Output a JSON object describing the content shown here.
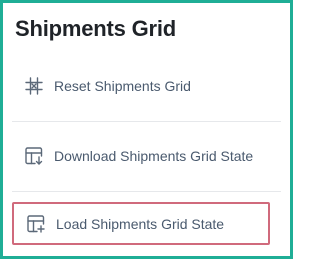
{
  "panel": {
    "title": "Shipments Grid"
  },
  "menu": {
    "items": [
      {
        "label": "Reset Shipments Grid",
        "icon": "grid-reset-icon"
      },
      {
        "label": "Download Shipments Grid State",
        "icon": "grid-download-icon"
      },
      {
        "label": "Load Shipments Grid State",
        "icon": "grid-load-icon",
        "selected": true
      }
    ]
  },
  "colors": {
    "frame_border": "#1fae96",
    "selection_outline": "#d06a7c",
    "label_text": "#4a5a6e",
    "icon_stroke": "#5b6878",
    "title_text": "#1f2328"
  }
}
